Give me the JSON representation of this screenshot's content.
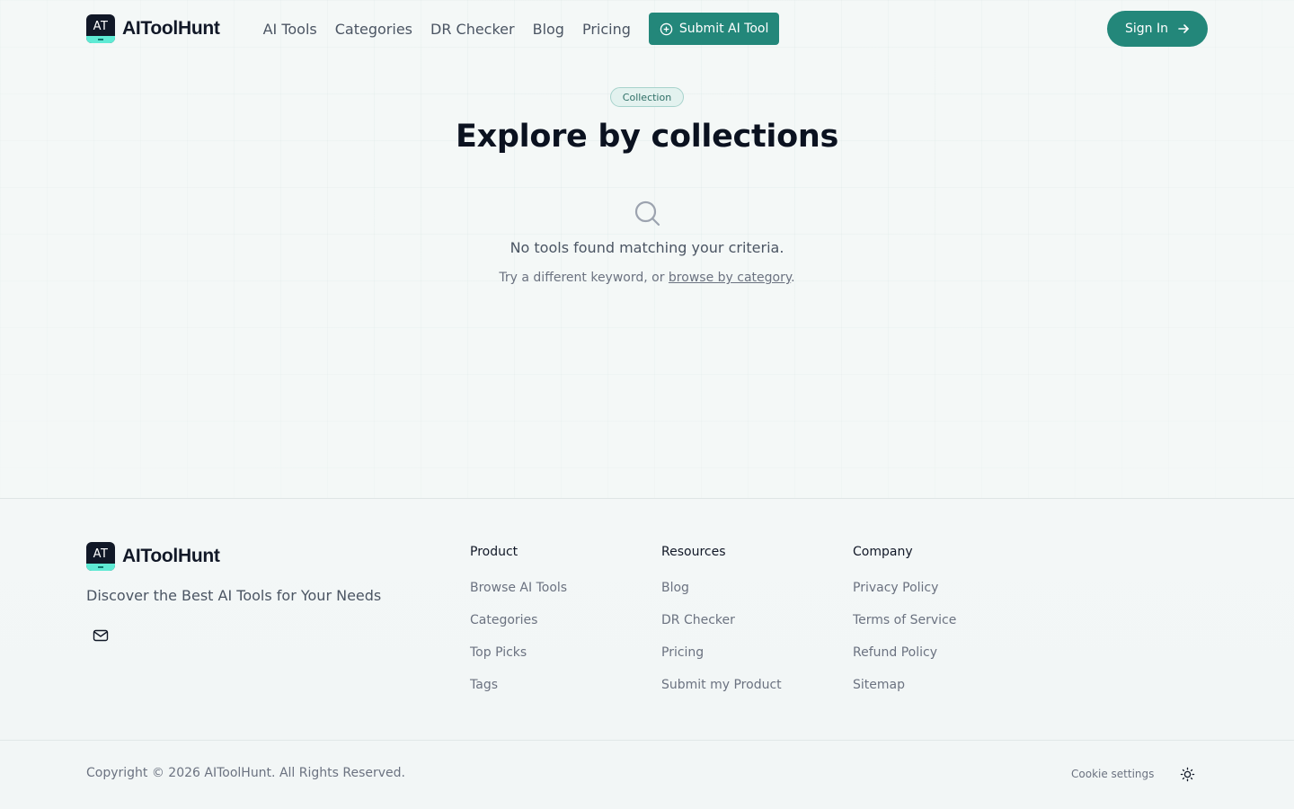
{
  "brand": {
    "logo_mark": "AT",
    "name": "AIToolHunt",
    "accent_color": "#23877a"
  },
  "header": {
    "nav": [
      {
        "label": "AI Tools"
      },
      {
        "label": "Categories"
      },
      {
        "label": "DR Checker"
      },
      {
        "label": "Blog"
      },
      {
        "label": "Pricing"
      }
    ],
    "submit_label": "Submit AI Tool",
    "submit_icon": "plus-circle-icon",
    "signin_label": "Sign In",
    "signin_icon": "arrow-right-icon"
  },
  "hero": {
    "badge": "Collection",
    "title": "Explore by collections"
  },
  "empty_state": {
    "icon": "search-icon",
    "message": "No tools found matching your criteria.",
    "sub_prefix": "Try a different keyword, or ",
    "sub_link": "browse by category",
    "sub_suffix": "."
  },
  "footer": {
    "tagline": "Discover the Best AI Tools for Your Needs",
    "mail_icon": "mail-icon",
    "columns": [
      {
        "title": "Product",
        "links": [
          "Browse AI Tools",
          "Categories",
          "Top Picks",
          "Tags"
        ]
      },
      {
        "title": "Resources",
        "links": [
          "Blog",
          "DR Checker",
          "Pricing",
          "Submit my Product"
        ]
      },
      {
        "title": "Company",
        "links": [
          "Privacy Policy",
          "Terms of Service",
          "Refund Policy",
          "Sitemap"
        ]
      }
    ],
    "copyright": "Copyright © 2026 AIToolHunt. All Rights Reserved.",
    "cookie_label": "Cookie settings",
    "theme_icon": "sun-icon"
  }
}
